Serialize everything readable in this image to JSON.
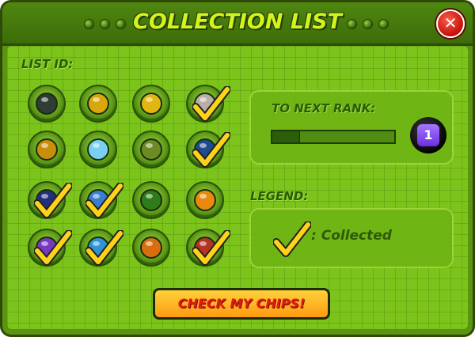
{
  "window": {
    "title": "COLLECTION LIST"
  },
  "list": {
    "label": "LIST ID:",
    "chips": [
      {
        "color": "#303c34",
        "collected": false
      },
      {
        "color": "#d9a60c",
        "collected": false
      },
      {
        "color": "#e2b510",
        "collected": false
      },
      {
        "color": "#b8b0a6",
        "collected": true
      },
      {
        "color": "#c98e0c",
        "collected": false
      },
      {
        "color": "#7ad0f2",
        "collected": false
      },
      {
        "color": "#6d8a24",
        "collected": false
      },
      {
        "color": "#1f4c8e",
        "collected": true
      },
      {
        "color": "#22307c",
        "collected": true
      },
      {
        "color": "#3b7ed0",
        "collected": true
      },
      {
        "color": "#2f7a1a",
        "collected": false
      },
      {
        "color": "#e98a0f",
        "collected": false
      },
      {
        "color": "#7838c0",
        "collected": true
      },
      {
        "color": "#2f93d4",
        "collected": true
      },
      {
        "color": "#d86e10",
        "collected": false
      },
      {
        "color": "#b33424",
        "collected": true
      }
    ]
  },
  "rank": {
    "label": "TO NEXT RANK:",
    "progress": 0.22,
    "badge": "1"
  },
  "legend": {
    "label": "LEGEND:",
    "collected_text": ": Collected"
  },
  "cta": {
    "label": "CHECK MY CHIPS!"
  },
  "icons": {
    "close": "close-icon",
    "check": "checkmark-icon"
  }
}
